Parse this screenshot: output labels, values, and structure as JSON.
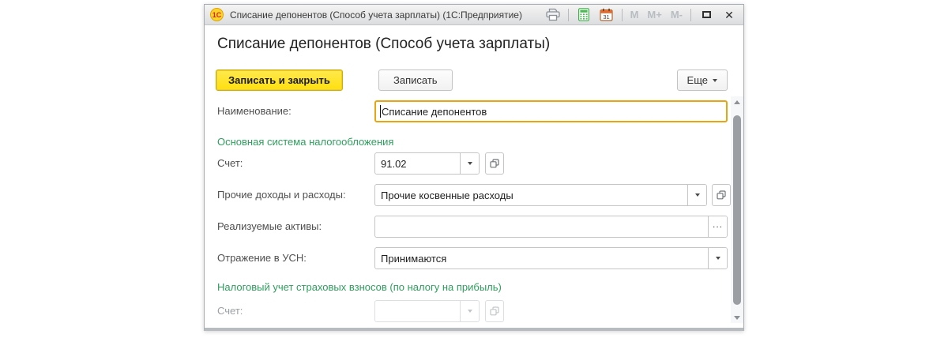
{
  "titlebar": {
    "logo": "1С",
    "title": "Списание депонентов (Способ учета зарплаты)  (1С:Предприятие)",
    "calendar_day": "31",
    "memory": [
      "M",
      "M+",
      "M-"
    ]
  },
  "header": {
    "title": "Списание депонентов (Способ учета зарплаты)"
  },
  "toolbar": {
    "save_close": "Записать и закрыть",
    "save": "Записать",
    "more": "Еще"
  },
  "form": {
    "name": {
      "label": "Наименование:",
      "value": "Списание депонентов"
    },
    "section_main": "Основная система налогообложения",
    "account": {
      "label": "Счет:",
      "value": "91.02"
    },
    "other_income": {
      "label": "Прочие доходы и расходы:",
      "value": "Прочие косвенные расходы"
    },
    "assets": {
      "label": "Реализуемые активы:",
      "value": "",
      "more": "..."
    },
    "usn": {
      "label": "Отражение в УСН:",
      "value": "Принимаются"
    },
    "section_tax": "Налоговый учет страховых взносов (по налогу на прибыль)",
    "account_tax": {
      "label": "Счет:",
      "value": ""
    }
  },
  "colors": {
    "accent_yellow": "#ffe121",
    "focus_border": "#e7a512",
    "section_green": "#2e9e5c",
    "logo_red": "#d62718"
  }
}
